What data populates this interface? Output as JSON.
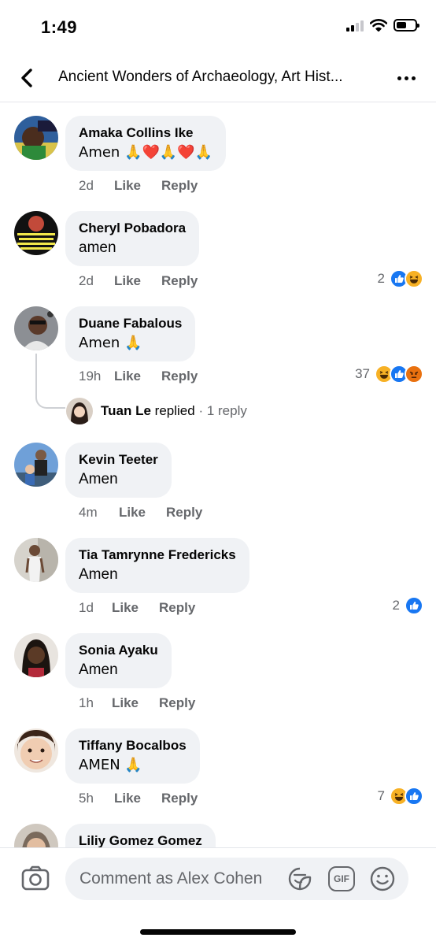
{
  "status": {
    "time": "1:49"
  },
  "nav": {
    "title": "Ancient Wonders of Archaeology, Art Hist..."
  },
  "comments": [
    {
      "name": "Amaka Collins Ike",
      "text": "Amen 🙏❤️🙏❤️🙏",
      "time": "2d",
      "like": "Like",
      "reply": "Reply",
      "reaction_count": ""
    },
    {
      "name": "Cheryl Pobadora",
      "text": "amen",
      "time": "2d",
      "like": "Like",
      "reply": "Reply",
      "reaction_count": "2"
    },
    {
      "name": "Duane Fabalous",
      "text": "Amen 🙏",
      "time": "19h",
      "like": "Like",
      "reply": "Reply",
      "reaction_count": "37",
      "replies": {
        "name": "Tuan Le",
        "replied": "replied",
        "count": "· 1 reply"
      }
    },
    {
      "name": "Kevin Teeter",
      "text": "Amen",
      "time": "4m",
      "like": "Like",
      "reply": "Reply",
      "reaction_count": ""
    },
    {
      "name": "Tia Tamrynne Fredericks",
      "text": "Amen",
      "time": "1d",
      "like": "Like",
      "reply": "Reply",
      "reaction_count": "2"
    },
    {
      "name": "Sonia Ayaku",
      "text": "Amen",
      "time": "1h",
      "like": "Like",
      "reply": "Reply",
      "reaction_count": ""
    },
    {
      "name": "Tiffany Bocalbos",
      "text": "AMEN 🙏",
      "time": "5h",
      "like": "Like",
      "reply": "Reply",
      "reaction_count": "7"
    },
    {
      "name": "Liliy Gomez Gomez"
    }
  ],
  "composer": {
    "placeholder": "Comment as Alex Cohen",
    "gif_label": "GIF"
  },
  "colors": {
    "like_blue": "#1877f2",
    "haha_yellow": "#f7b125",
    "angry_orange": "#e9710f",
    "bubble": "#f0f2f5",
    "meta_gray": "#65676b"
  },
  "icons": {
    "back": "chevron-left-icon",
    "more": "more-dots-icon",
    "camera": "camera-icon",
    "sticker": "sticker-icon",
    "gif": "gif-icon",
    "emoji": "smiley-icon",
    "reactions": [
      "like-reaction-icon",
      "haha-reaction-icon",
      "angry-reaction-icon"
    ]
  }
}
